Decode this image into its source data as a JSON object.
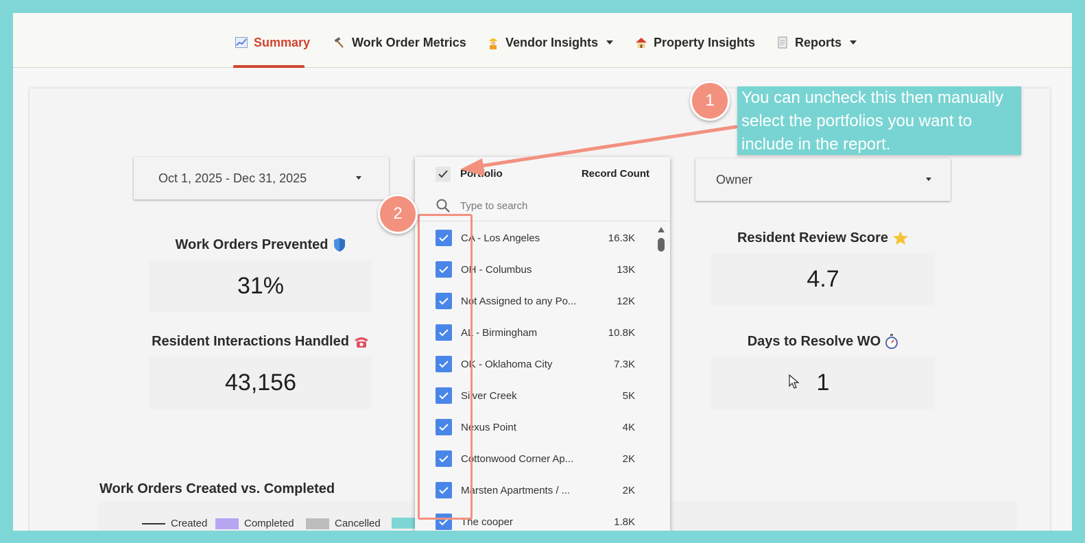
{
  "nav": {
    "items": [
      {
        "label": "Summary",
        "icon": "chart-icon",
        "active": true
      },
      {
        "label": "Work Order Metrics",
        "icon": "hammer-icon"
      },
      {
        "label": "Vendor Insights",
        "icon": "worker-icon",
        "dropdown": true
      },
      {
        "label": "Property Insights",
        "icon": "house-icon"
      },
      {
        "label": "Reports",
        "icon": "document-icon",
        "dropdown": true
      }
    ]
  },
  "filters": {
    "date_range": "Oct 1, 2025 - Dec 31, 2025",
    "owner": "Owner"
  },
  "kpis": {
    "prevented": {
      "title": "Work Orders Prevented",
      "value": "31%",
      "icon": "shield-icon"
    },
    "interactions": {
      "title": "Resident Interactions Handled",
      "value": "43,156",
      "icon": "telephone-icon"
    },
    "review": {
      "title": "Resident Review Score",
      "value": "4.7",
      "icon": "star-icon"
    },
    "days": {
      "title": "Days to Resolve WO",
      "value": "1",
      "icon": "stopwatch-icon"
    }
  },
  "chart_section": {
    "title": "Work Orders Created vs. Completed",
    "legend": [
      {
        "label": "Created",
        "color": "#333333",
        "kind": "line"
      },
      {
        "label": "Completed",
        "color": "#b6a6f2",
        "kind": "swatch"
      },
      {
        "label": "Cancelled",
        "color": "#bdbdbd",
        "kind": "swatch"
      }
    ]
  },
  "portfolio_dropdown": {
    "header_label": "Portfolio",
    "record_count_label": "Record Count",
    "search_placeholder": "Type to search",
    "items": [
      {
        "name": "CA - Los Angeles",
        "count": "16.3K"
      },
      {
        "name": "OH - Columbus",
        "count": "13K"
      },
      {
        "name": "Not Assigned to any Po...",
        "count": "12K"
      },
      {
        "name": "AL - Birmingham",
        "count": "10.8K"
      },
      {
        "name": "OK - Oklahoma City",
        "count": "7.3K"
      },
      {
        "name": "Silver Creek",
        "count": "5K"
      },
      {
        "name": "Nexus Point",
        "count": "4K"
      },
      {
        "name": "Cottonwood Corner Ap...",
        "count": "2K"
      },
      {
        "name": "Marsten Apartments / ...",
        "count": "2K"
      },
      {
        "name": "The cooper",
        "count": "1.8K"
      }
    ]
  },
  "annotations": {
    "badge_1": "1",
    "badge_2": "2",
    "callout_text": "You can uncheck this then manually select the portfolios you want to include in the report.",
    "accent_color": "#f3917f",
    "callout_color": "#78d4d2"
  }
}
